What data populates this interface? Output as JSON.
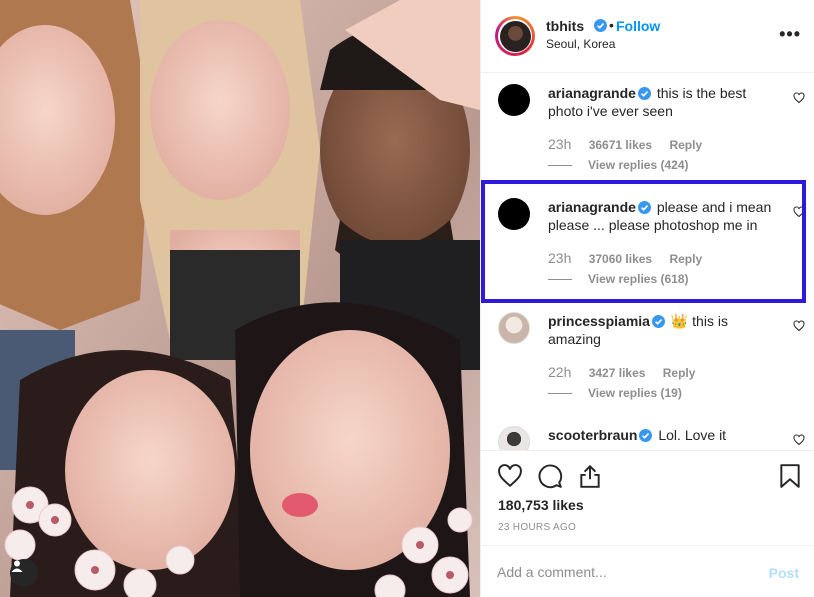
{
  "post": {
    "username": "tbhits",
    "follow_label": "Follow",
    "dot": "•",
    "location": "Seoul, Korea",
    "more_label": "•••"
  },
  "comments": [
    {
      "username": "arianagrande",
      "text": "this is the best photo i've ever seen",
      "time": "23h",
      "likes": "36671 likes",
      "reply_label": "Reply",
      "view_replies": "View replies (424)",
      "avatar": "black-circle"
    },
    {
      "username": "arianagrande",
      "text": "please and i mean please ... please photoshop me in",
      "time": "23h",
      "likes": "37060 likes",
      "reply_label": "Reply",
      "view_replies": "View replies (618)",
      "avatar": "black-circle"
    },
    {
      "username": "princesspiamia",
      "emoji": "👑",
      "text": "this is amazing",
      "time": "22h",
      "likes": "3427 likes",
      "reply_label": "Reply",
      "view_replies": "View replies (19)",
      "avatar": "user-photo"
    },
    {
      "username": "scooterbraun",
      "text": "Lol. Love it",
      "avatar": "user-photo"
    }
  ],
  "actions": {
    "likes_count": "180,753 likes",
    "timestamp": "23 HOURS AGO"
  },
  "add_comment": {
    "placeholder": "Add a comment...",
    "post_label": "Post"
  },
  "colors": {
    "link_blue": "#0095f6",
    "highlight_box": "#2e1bd9",
    "muted": "#8e8e8e",
    "post_disabled": "#b2dffc"
  },
  "icons": [
    "heart-icon",
    "comment-icon",
    "share-icon",
    "bookmark-icon",
    "verified-badge-icon",
    "user-tag-icon",
    "more-options-icon"
  ]
}
